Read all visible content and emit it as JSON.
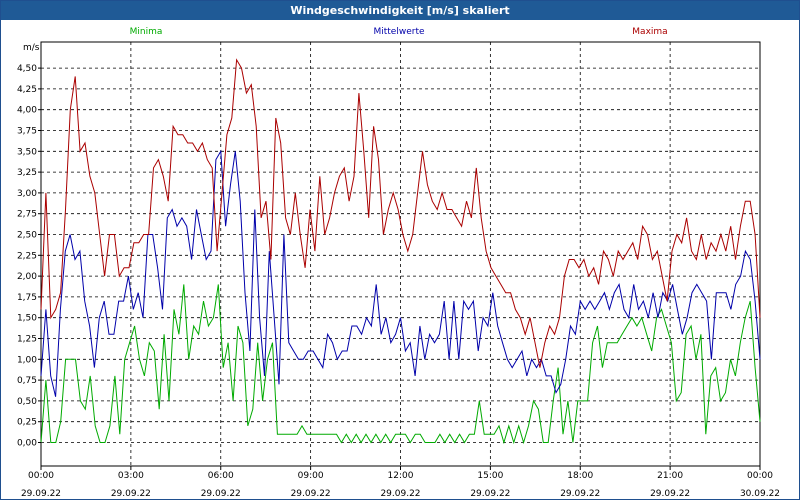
{
  "window": {
    "title": "Windgeschwindigkeit [m/s] skaliert"
  },
  "colors": {
    "minima": "#00aa00",
    "mittel": "#0000aa",
    "maxima": "#aa0000",
    "grid": "#000000"
  },
  "chart_data": {
    "type": "line",
    "title": "Windgeschwindigkeit [m/s] skaliert",
    "ylabel": "m/s",
    "xlabel": "",
    "ylim": [
      0,
      4.75
    ],
    "xlim_hours": [
      0,
      24
    ],
    "grid": true,
    "legend_placement": "top",
    "y_ticks": [
      "0,00",
      "0,25",
      "0,50",
      "0,75",
      "1,00",
      "1,25",
      "1,50",
      "1,75",
      "2,00",
      "2,25",
      "2,50",
      "2,75",
      "3,00",
      "3,25",
      "3,50",
      "3,75",
      "4,00",
      "4,25",
      "4,50"
    ],
    "x_ticks": [
      {
        "time": "00:00",
        "date": "29.09.22"
      },
      {
        "time": "03:00",
        "date": "29.09.22"
      },
      {
        "time": "06:00",
        "date": "29.09.22"
      },
      {
        "time": "09:00",
        "date": "29.09.22"
      },
      {
        "time": "12:00",
        "date": "29.09.22"
      },
      {
        "time": "15:00",
        "date": "29.09.22"
      },
      {
        "time": "18:00",
        "date": "29.09.22"
      },
      {
        "time": "21:00",
        "date": "29.09.22"
      },
      {
        "time": "00:00",
        "date": "30.09.22"
      }
    ],
    "series": [
      {
        "name": "Minima",
        "color": "#00aa00",
        "values": [
          0,
          0.75,
          0,
          0,
          0.25,
          1,
          1,
          1,
          0.5,
          0.4,
          0.8,
          0.2,
          0,
          0,
          0.2,
          0.8,
          0.1,
          1,
          1.2,
          1.4,
          1,
          0.8,
          1.2,
          1.1,
          0.4,
          1.3,
          0.5,
          1.6,
          1.3,
          1.9,
          1,
          1.4,
          1.3,
          1.7,
          1.4,
          1.5,
          1.9,
          0.9,
          1.2,
          0.5,
          1.4,
          1.2,
          0.2,
          0.4,
          1.2,
          0.5,
          1,
          1.2,
          0.1,
          0.1,
          0.1,
          0.1,
          0.1,
          0.2,
          0.1,
          0.1,
          0.1,
          0.1,
          0.1,
          0.1,
          0.1,
          0,
          0.1,
          0,
          0.1,
          0,
          0.1,
          0,
          0.1,
          0,
          0.1,
          0,
          0.1,
          0.1,
          0.1,
          0,
          0.1,
          0.1,
          0,
          0,
          0,
          0.1,
          0,
          0.1,
          0,
          0.1,
          0,
          0.1,
          0.1,
          0.5,
          0.1,
          0.1,
          0.1,
          0.2,
          0,
          0.2,
          0,
          0.2,
          0,
          0.2,
          0.5,
          0.4,
          0,
          0,
          0.5,
          0.9,
          0.1,
          0.5,
          0,
          0.5,
          0.5,
          0.5,
          1.2,
          1.4,
          0.9,
          1.2,
          1.2,
          1.2,
          1.3,
          1.4,
          1.5,
          1.4,
          1.5,
          1.3,
          1.1,
          1.5,
          1.6,
          1.4,
          1.2,
          0.5,
          0.6,
          1.3,
          1.4,
          1,
          1.3,
          0.1,
          0.8,
          0.9,
          0.5,
          0.6,
          1,
          0.8,
          1.2,
          1.5,
          1.7,
          0.9,
          0.25
        ]
      },
      {
        "name": "Mittelwerte",
        "color": "#0000aa",
        "values": [
          0.8,
          1.6,
          0.8,
          0.55,
          1.6,
          2.3,
          2.5,
          2.2,
          2.3,
          1.7,
          1.4,
          0.9,
          1.5,
          1.7,
          1.3,
          1.3,
          1.7,
          1.7,
          2,
          1.6,
          1.8,
          1.5,
          2.5,
          2.5,
          2.1,
          1.6,
          2.7,
          2.8,
          2.6,
          2.7,
          2.6,
          2.2,
          2.8,
          2.5,
          2.2,
          2.3,
          3.4,
          3.5,
          2.6,
          3.1,
          3.5,
          2.9,
          1.8,
          1.1,
          2.8,
          1.5,
          0.8,
          2.3,
          1.5,
          0.7,
          2.5,
          1.2,
          1.1,
          1,
          1,
          1.1,
          1.1,
          1,
          0.9,
          1.3,
          1.2,
          1,
          1.1,
          1.1,
          1.4,
          1.4,
          1.3,
          1.5,
          1.4,
          1.9,
          1.3,
          1.5,
          1.2,
          1.3,
          1.5,
          1.1,
          1.2,
          0.8,
          1.4,
          1,
          1.3,
          1.2,
          1.3,
          1.7,
          1,
          1.7,
          1,
          1.7,
          1.6,
          1.7,
          1.1,
          1.5,
          1.4,
          1.8,
          1.4,
          1.2,
          1,
          0.9,
          1,
          1.1,
          0.8,
          1,
          0.9,
          1,
          0.8,
          0.8,
          0.6,
          0.7,
          1,
          1.4,
          1.3,
          1.7,
          1.6,
          1.7,
          1.6,
          1.7,
          1.8,
          1.6,
          1.8,
          1.9,
          1.6,
          1.5,
          1.9,
          1.6,
          1.7,
          1.5,
          1.8,
          1.5,
          1.8,
          1.7,
          1.9,
          1.6,
          1.3,
          1.5,
          1.8,
          1.9,
          1.8,
          1.7,
          1,
          1.8,
          1.8,
          1.8,
          1.6,
          1.9,
          2,
          2.3,
          2.2,
          1.7,
          1
        ]
      },
      {
        "name": "Maxima",
        "color": "#aa0000",
        "values": [
          1.6,
          3,
          1.5,
          1.6,
          1.8,
          2.8,
          4,
          4.4,
          3.5,
          3.6,
          3.2,
          3,
          2.5,
          2,
          2.5,
          2.5,
          2,
          2.1,
          2.1,
          2.4,
          2.4,
          2.5,
          2.5,
          3.3,
          3.4,
          3.2,
          2.9,
          3.8,
          3.7,
          3.7,
          3.6,
          3.6,
          3.5,
          3.6,
          3.4,
          3.3,
          2.3,
          3,
          3.7,
          3.9,
          4.6,
          4.5,
          4.2,
          4.3,
          3.8,
          2.7,
          2.9,
          2.2,
          3.9,
          3.6,
          2.7,
          2.5,
          3,
          2.5,
          2.1,
          2.8,
          2.3,
          3.2,
          2.5,
          2.7,
          3,
          3.2,
          3.3,
          2.9,
          3.2,
          4.2,
          3.5,
          2.7,
          3.8,
          3.4,
          2.5,
          2.8,
          3,
          2.8,
          2.5,
          2.3,
          2.5,
          3,
          3.5,
          3.1,
          2.9,
          2.8,
          3,
          2.8,
          2.8,
          2.7,
          2.6,
          2.9,
          2.7,
          3.3,
          2.7,
          2.3,
          2.1,
          2,
          1.9,
          1.8,
          1.8,
          1.6,
          1.5,
          1.3,
          1.5,
          1.2,
          0.9,
          1.2,
          1.4,
          1.3,
          1.5,
          2,
          2.2,
          2.2,
          2.1,
          2.2,
          2,
          2.1,
          1.9,
          2.3,
          2.2,
          2,
          2.3,
          2.2,
          2.3,
          2.4,
          2.2,
          2.6,
          2.5,
          2.2,
          2.3,
          2,
          1.7,
          2.3,
          2.5,
          2.4,
          2.7,
          2.3,
          2.2,
          2.5,
          2.2,
          2.4,
          2.3,
          2.5,
          2.3,
          2.6,
          2.2,
          2.6,
          2.9,
          2.9,
          2.5,
          1.5
        ]
      }
    ]
  }
}
